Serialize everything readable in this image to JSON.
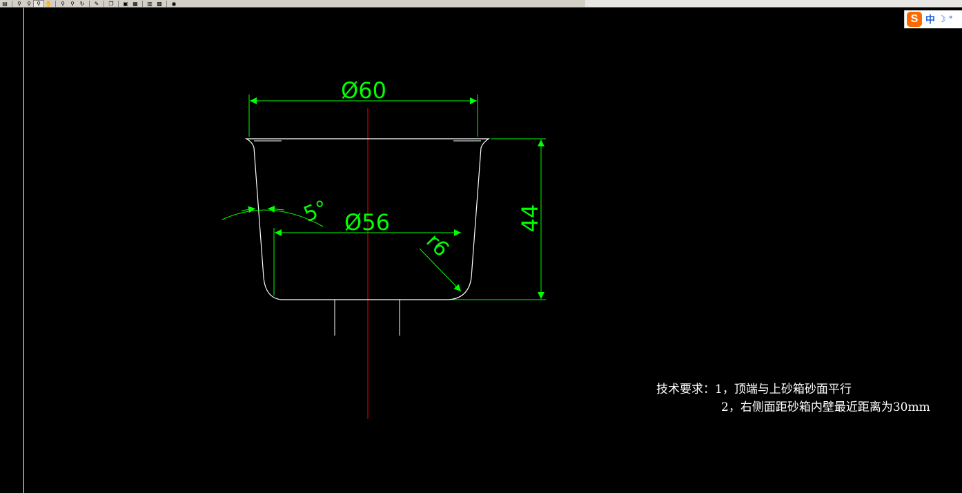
{
  "toolbar": {
    "icons": [
      "save-icon",
      "zoom-realtime-icon",
      "zoom-previous-icon",
      "zoom-window-icon",
      "pan-icon",
      "zoom-in-icon",
      "zoom-out-icon",
      "regen-icon",
      "match-properties-icon",
      "copy-icon",
      "paste-icon",
      "block-icon",
      "properties-icon",
      "design-center-icon",
      "help-icon"
    ]
  },
  "ime": {
    "logo": "S",
    "lang": "中",
    "moon": "☽",
    "dot": "°"
  },
  "dimensions": {
    "top_diameter": "Ø60",
    "inner_diameter": "Ø56",
    "height": "44",
    "radius": "r6",
    "angle": "5°"
  },
  "notes": {
    "line1": "技术要求：1，顶端与上砂箱砂面平行",
    "line2": "2，右侧面距砂箱内壁最近距离为30mm"
  },
  "colors": {
    "background": "#000000",
    "dimension": "#00ff00",
    "outline": "#ffffff",
    "centerline": "#ff0000"
  }
}
